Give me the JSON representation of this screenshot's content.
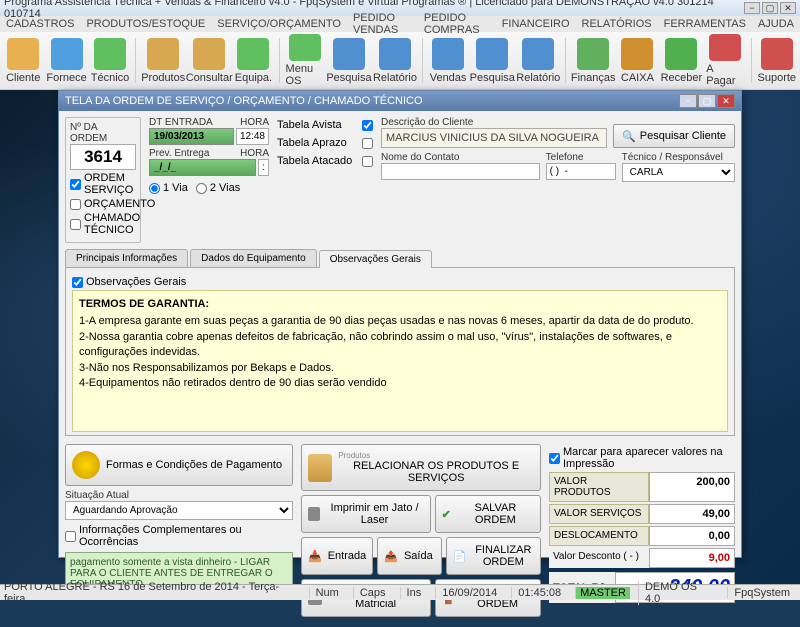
{
  "app": {
    "title": "Programa Assistência Técnica + Vendas & Financeiro v4.0 - FpqSystem e Virtual Programas ® | Licenciado para DEMONSTRAÇÃO v4.0 301214 010714"
  },
  "menu": [
    "CADASTROS",
    "PRODUTOS/ESTOQUE",
    "SERVIÇO/ORÇAMENTO",
    "PEDIDO VENDAS",
    "PEDIDO COMPRAS",
    "FINANCEIRO",
    "RELATÓRIOS",
    "FERRAMENTAS",
    "AJUDA"
  ],
  "toolbar": [
    {
      "label": "Cliente",
      "color": "#e8b050"
    },
    {
      "label": "Fornece",
      "color": "#50a0e0"
    },
    {
      "label": "Técnico",
      "color": "#60c060"
    },
    {
      "sep": true
    },
    {
      "label": "Produtos",
      "color": "#d8a850"
    },
    {
      "label": "Consultar",
      "color": "#d8a850"
    },
    {
      "label": "Equipa.",
      "color": "#60c060"
    },
    {
      "sep": true
    },
    {
      "label": "Menu OS",
      "color": "#60c060"
    },
    {
      "label": "Pesquisa",
      "color": "#5090d0"
    },
    {
      "label": "Relatório",
      "color": "#5090d0"
    },
    {
      "sep": true
    },
    {
      "label": "Vendas",
      "color": "#5090d0"
    },
    {
      "label": "Pesquisa",
      "color": "#5090d0"
    },
    {
      "label": "Relatório",
      "color": "#5090d0"
    },
    {
      "sep": true
    },
    {
      "label": "Finanças",
      "color": "#60b060"
    },
    {
      "label": "CAIXA",
      "color": "#d09030"
    },
    {
      "label": "Receber",
      "color": "#50b050"
    },
    {
      "label": "A Pagar",
      "color": "#d05050"
    },
    {
      "sep": true
    },
    {
      "label": "Suporte",
      "color": "#d05050"
    }
  ],
  "dialog": {
    "title": "TELA DA ORDEM DE SERVIÇO / ORÇAMENTO / CHAMADO TÉCNICO",
    "order_label": "Nº DA ORDEM",
    "order_num": "3614",
    "dt_entrada_lbl": "DT ENTRADA",
    "hora_lbl": "HORA",
    "dt_entrada": "19/03/2013",
    "hora": "12:48",
    "prev_entrega_lbl": "Prev. Entrega",
    "prev_entrega": "_/_/_",
    "hora2": ":",
    "chk_os": "ORDEM SERVIÇO",
    "chk_orc": "ORÇAMENTO",
    "chk_ct": "CHAMADO TÉCNICO",
    "via1": "1 Via",
    "via2": "2 Vias",
    "tabela_avista": "Tabela Avista",
    "tabela_aprazo": "Tabela Aprazo",
    "tabela_atacado": "Tabela Atacado",
    "desc_cliente_lbl": "Descrição do Cliente",
    "cliente_nome": "MARCIUS VINICIUS DA SILVA NOGUEIRA",
    "pesquisar_cliente": "Pesquisar Cliente",
    "nome_contato_lbl": "Nome do Contato",
    "telefone_lbl": "Telefone",
    "telefone_val": "( )  -",
    "tecnico_lbl": "Técnico / Responsável",
    "tecnico_val": "CARLA",
    "tabs": [
      "Principais Informações",
      "Dados do Equipamento",
      "Observações Gerais"
    ],
    "obs_check": "Observações Gerais",
    "obs_title": "TERMOS DE GARANTIA:",
    "obs_l1": "1-A empresa garante em suas peças a garantia de 90 dias peças usadas e nas novas 6 meses, apartir da data de do produto.",
    "obs_l2": "2-Nossa garantia cobre apenas defeitos de fabricação, não cobrindo assim o mal uso, \"vírus\", instalações de softwares, e configurações indevidas.",
    "obs_l3": "3-Não nos Responsabilizamos por Bekaps e Dados.",
    "obs_l4": "4-Equipamentos não retirados dentro de 90 dias serão vendido",
    "formas_pag": "Formas e Condições de Pagamento",
    "situacao_lbl": "Situação Atual",
    "situacao_val": "Aguardando Aprovação",
    "info_comp": "Informações Complementares ou Ocorrências",
    "note": "pagamento somente a vista dinheiro - LIGAR PARA O CLIENTE ANTES DE ENTREGAR O EQUIPAMENTO",
    "relacionar": "RELACIONAR OS PRODUTOS E SERVIÇOS",
    "produtos_lbl": "Produtos",
    "imprimir_laser": "Imprimir em Jato / Laser",
    "entrada": "Entrada",
    "saida": "Saída",
    "imprimir_matricial": "Imprimir na Matricial",
    "salvar": "SALVAR ORDEM",
    "finalizar": "FINALIZAR ORDEM",
    "sair": "SAIR DA ORDEM",
    "marcar_impressao": "Marcar para aparecer valores na Impressão",
    "val_prod_lbl": "VALOR PRODUTOS",
    "val_prod": "200,00",
    "val_serv_lbl": "VALOR SERVIÇOS",
    "val_serv": "49,00",
    "desloc_lbl": "DESLOCAMENTO",
    "desloc": "0,00",
    "desconto_lbl": "Valor Desconto ( - )",
    "desconto": "9,00",
    "total_lbl": "TOTAL R$",
    "total": "240,00"
  },
  "status": {
    "loc": "PORTO ALEGRE - RS 16 de Setembro de 2014 - Terça-feira",
    "num": "Num",
    "caps": "Caps",
    "ins": "Ins",
    "date": "16/09/2014",
    "time": "01:45:08",
    "master": "MASTER",
    "demo": "DEMO OS 4.0",
    "sys": "FpqSystem"
  }
}
